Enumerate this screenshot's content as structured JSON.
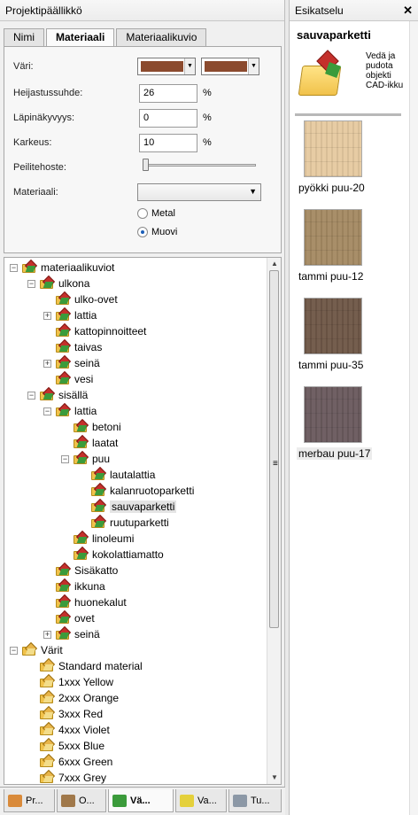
{
  "left_panel": {
    "title": "Projektipäällikkö",
    "tabs": [
      "Nimi",
      "Materiaali",
      "Materiaalikuvio"
    ],
    "active_tab": "Materiaali",
    "fields": {
      "color_label": "Väri:",
      "color_swatch_1": "#8b4a2e",
      "color_swatch_2": "#8b4a2e",
      "reflection_label": "Heijastussuhde:",
      "reflection_value": "26",
      "transparency_label": "Läpinäkyvyys:",
      "transparency_value": "0",
      "roughness_label": "Karkeus:",
      "roughness_value": "10",
      "percent": "%",
      "finish_label": "Peilitehoste:",
      "finish_value": 0,
      "material_label": "Materiaali:",
      "material_value": "",
      "radio_metal": "Metal",
      "radio_plastic": "Muovi",
      "selected_radio": "Muovi"
    },
    "tree": {
      "root": "materiaalikuviot",
      "ulkona": "ulkona",
      "ulko_ovet": "ulko-ovet",
      "lattia1": "lattia",
      "kattopinnoitteet": "kattopinnoitteet",
      "taivas": "taivas",
      "seina1": "seinä",
      "vesi": "vesi",
      "sisalla": "sisällä",
      "lattia2": "lattia",
      "betoni": "betoni",
      "laatat": "laatat",
      "puu": "puu",
      "lautalattia": "lautalattia",
      "kalanruotoparketti": "kalanruotoparketti",
      "sauvaparketti": "sauvaparketti",
      "ruutuparketti": "ruutuparketti",
      "linoleumi": "linoleumi",
      "kokolattiamatto": "kokolattiamatto",
      "sisakatto": "Sisäkatto",
      "ikkuna": "ikkuna",
      "huonekalut": "huonekalut",
      "ovet": "ovet",
      "seina2": "seinä",
      "varit": "Värit",
      "standard": "Standard material",
      "yellow": "1xxx Yellow",
      "orange": "2xxx Orange",
      "red": "3xxx Red",
      "violet": "4xxx Violet",
      "blue": "5xxx Blue",
      "green": "6xxx Green",
      "grey": "7xxx Grey"
    },
    "bottom_tabs": [
      "Pr...",
      "O...",
      "Vä...",
      "Va...",
      "Tu..."
    ],
    "active_bottom_tab": "Vä..."
  },
  "right_panel": {
    "title": "Esikatselu",
    "close": "✕",
    "preview_title": "sauvaparketti",
    "hint": "Vedä ja pudota objekti CAD-ikku",
    "thumbnails": [
      {
        "label": "pyökki puu-20",
        "color": "#e6caa0"
      },
      {
        "label": "tammi puu-12",
        "color": "#a58a63"
      },
      {
        "label": "tammi puu-35",
        "color": "#6f5747"
      },
      {
        "label": "merbau puu-17",
        "color": "#6a5a5e"
      }
    ],
    "selected_thumbnail": "merbau puu-17"
  }
}
